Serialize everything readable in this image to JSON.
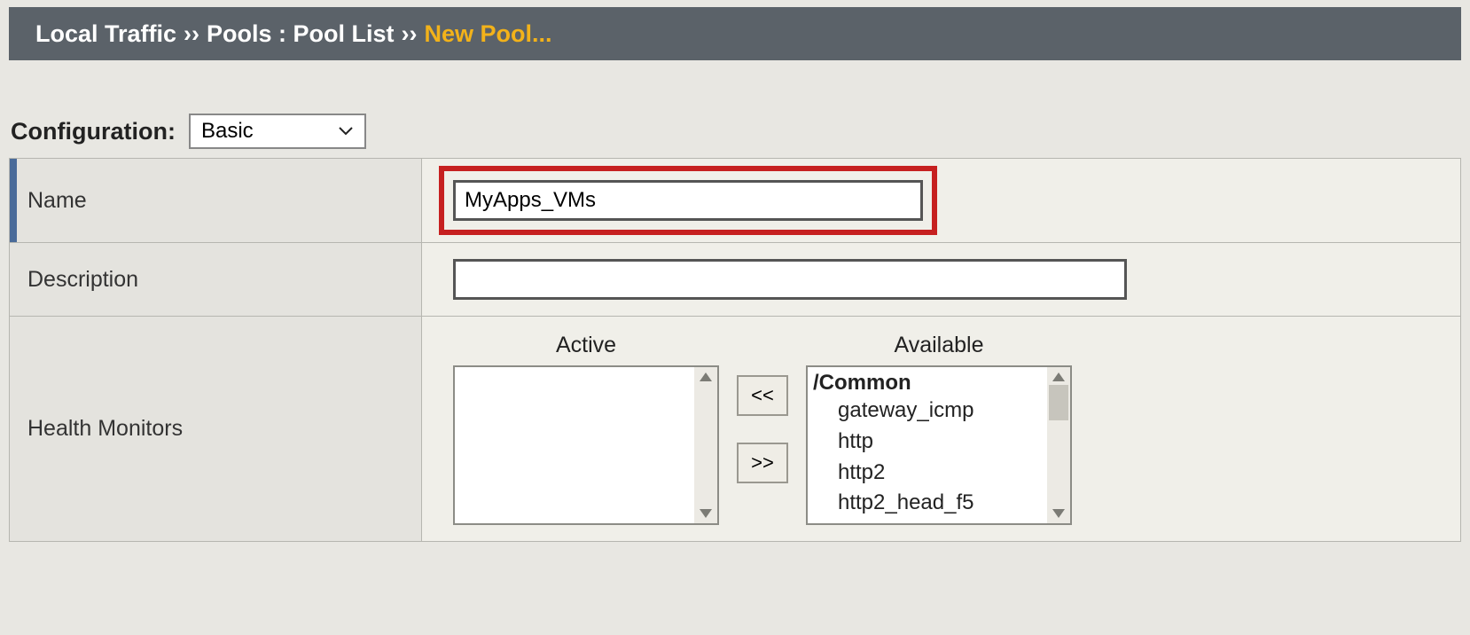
{
  "breadcrumb": {
    "item1": "Local Traffic",
    "sep": "››",
    "item2": "Pools : Pool List",
    "current": "New Pool..."
  },
  "config": {
    "label": "Configuration:",
    "selected": "Basic"
  },
  "form": {
    "name_label": "Name",
    "name_value": "MyApps_VMs",
    "description_label": "Description",
    "description_value": "",
    "monitors_label": "Health Monitors",
    "active_label": "Active",
    "available_label": "Available",
    "move_left": "<<",
    "move_right": ">>",
    "available_group": "/Common",
    "available_items": [
      "gateway_icmp",
      "http",
      "http2",
      "http2_head_f5"
    ]
  }
}
